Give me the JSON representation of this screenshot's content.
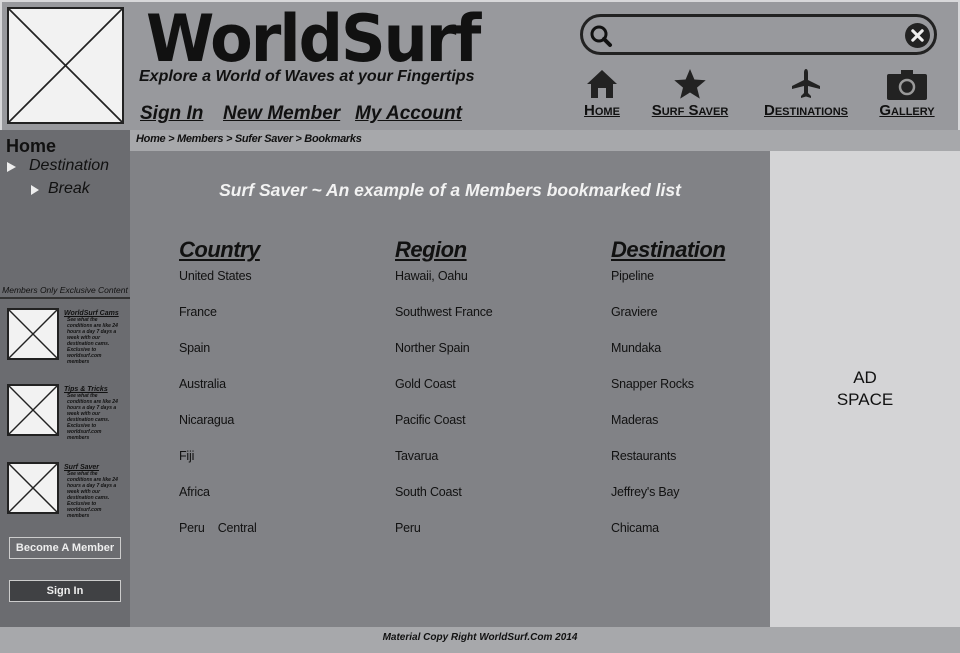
{
  "header": {
    "brand": "WorldSurf",
    "tagline": "Explore a World of Waves at your Fingertips",
    "links": [
      "Sign In",
      "New Member",
      "My Account"
    ],
    "search": {
      "value": "",
      "placeholder": ""
    },
    "nav": [
      {
        "label": "Home",
        "icon": "home-icon"
      },
      {
        "label": "Surf Saver",
        "icon": "star-icon"
      },
      {
        "label": "Destinations",
        "icon": "airplane-icon"
      },
      {
        "label": "Gallery",
        "icon": "camera-icon"
      }
    ]
  },
  "sidebar": {
    "home": "Home",
    "destination": "Destination",
    "break": "Break",
    "members_heading": "Members Only Exclusive Content",
    "promos": [
      {
        "title": "WorldSurf Cams",
        "text": "See what the conditions are like 24 hours a day 7 days a week with our destination cams. Exclusive to worldsurf.com members"
      },
      {
        "title": "Tips & Tricks",
        "text": "See what the conditions are like 24 hours a day 7 days a week with our destination cams. Exclusive to worldsurf.com members"
      },
      {
        "title": "Surf Saver",
        "text": "See what the conditions are like 24 hours a day 7 days a week with our destination cams. Exclusive to worldsurf.com members"
      }
    ],
    "become_member": "Become A Member",
    "sign_in": "Sign In"
  },
  "breadcrumb": "Home > Members > Sufer Saver > Bookmarks",
  "main": {
    "title": "Surf Saver ~ An example of a Members bookmarked list",
    "columns": [
      "Country",
      "Region",
      "Destination"
    ],
    "rows": [
      [
        "United States",
        "Hawaii, Oahu",
        "Pipeline"
      ],
      [
        "France",
        "Southwest France",
        "Graviere"
      ],
      [
        "Spain",
        "Norther Spain",
        "Mundaka"
      ],
      [
        "Australia",
        "Gold Coast",
        "Snapper Rocks"
      ],
      [
        "Nicaragua",
        "Pacific Coast",
        "Maderas"
      ],
      [
        "Fiji",
        "Tavarua",
        "Restaurants"
      ],
      [
        "Africa",
        "South Coast",
        "Jeffrey's Bay"
      ],
      [
        "Peru    Central",
        "Peru",
        "Chicama"
      ]
    ]
  },
  "ad": {
    "line1": "AD",
    "line2": "SPACE"
  },
  "footer": "Material Copy Right WorldSurf.Com 2014"
}
